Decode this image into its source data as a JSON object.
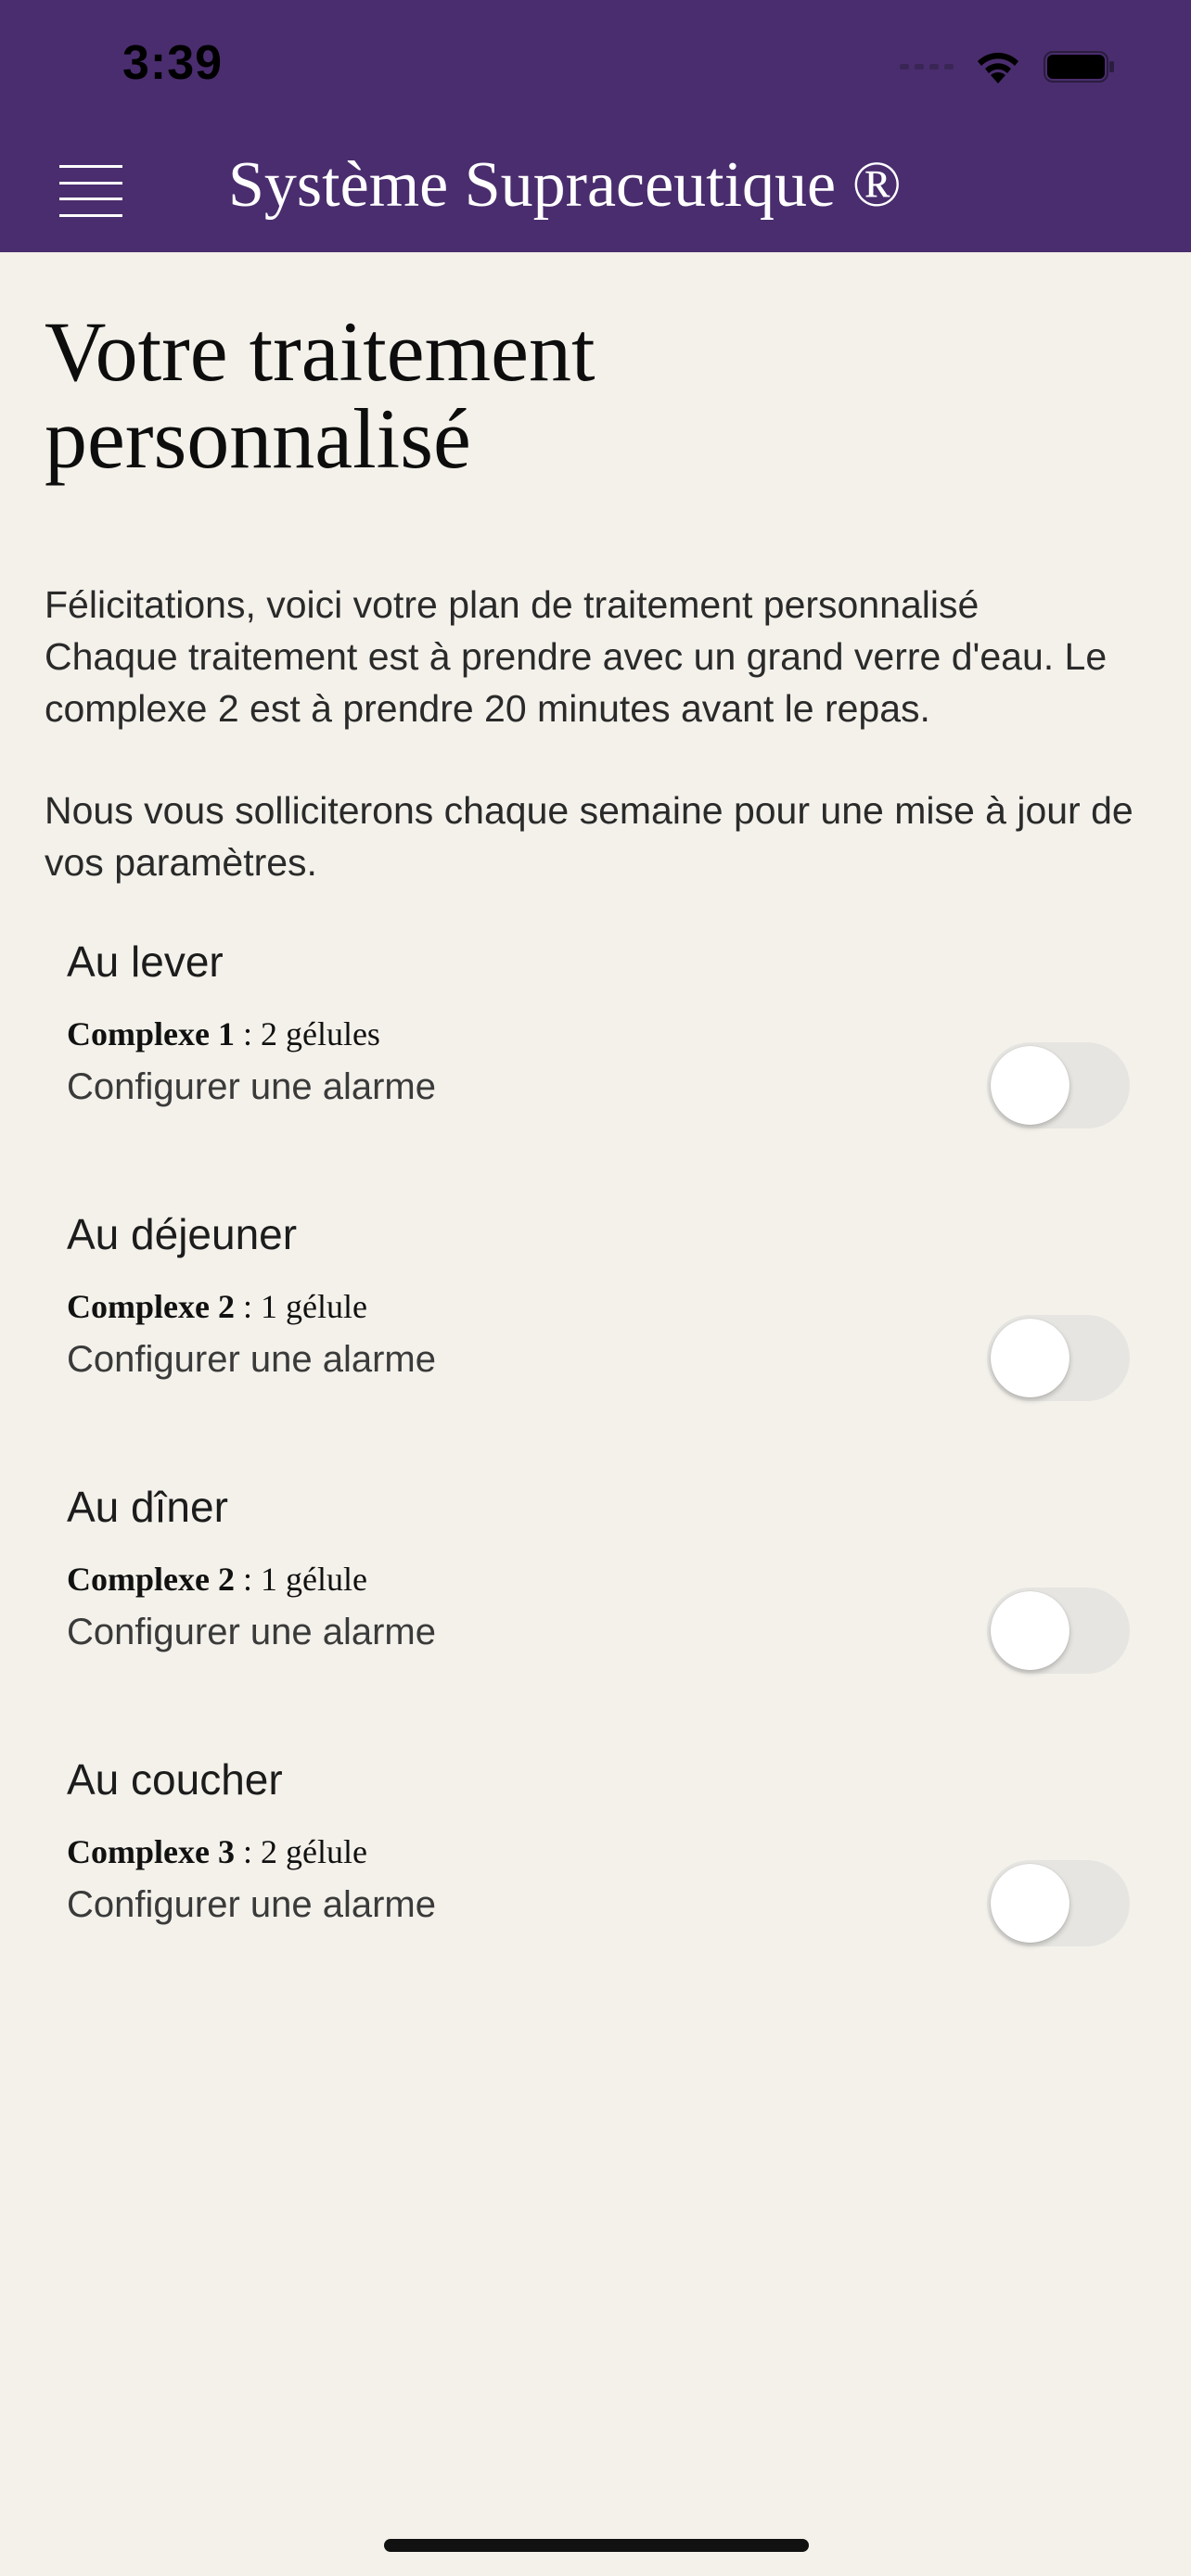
{
  "status_bar": {
    "time": "3:39"
  },
  "header": {
    "title": "Système Supraceutique ®",
    "background_color": "#4a2d6e",
    "menu_icon": "hamburger-menu-icon"
  },
  "page": {
    "title_line1": "Votre traitement",
    "title_line2": "personnalisé",
    "intro_line1": "Félicitations, voici votre plan de traitement personnalisé",
    "intro_line2": "Chaque traitement est à prendre avec un grand verre d'eau. Le complexe 2 est à prendre 20 minutes avant le repas.",
    "intro_line3": "Nous vous solliciterons chaque semaine pour une mise à jour de vos paramètres."
  },
  "schedule": [
    {
      "title": "Au lever",
      "complex": "Complexe 1",
      "dose": " : 2 gélules",
      "alarm_label": "Configurer une alarme",
      "alarm_enabled": false
    },
    {
      "title": "Au déjeuner",
      "complex": "Complexe 2",
      "dose": " : 1 gélule",
      "alarm_label": "Configurer une alarme",
      "alarm_enabled": false
    },
    {
      "title": "Au dîner",
      "complex": "Complexe 2",
      "dose": " : 1 gélule",
      "alarm_label": "Configurer une alarme",
      "alarm_enabled": false
    },
    {
      "title": "Au coucher",
      "complex": "Complexe 3",
      "dose": " : 2 gélule",
      "alarm_label": "Configurer une alarme",
      "alarm_enabled": false
    }
  ]
}
